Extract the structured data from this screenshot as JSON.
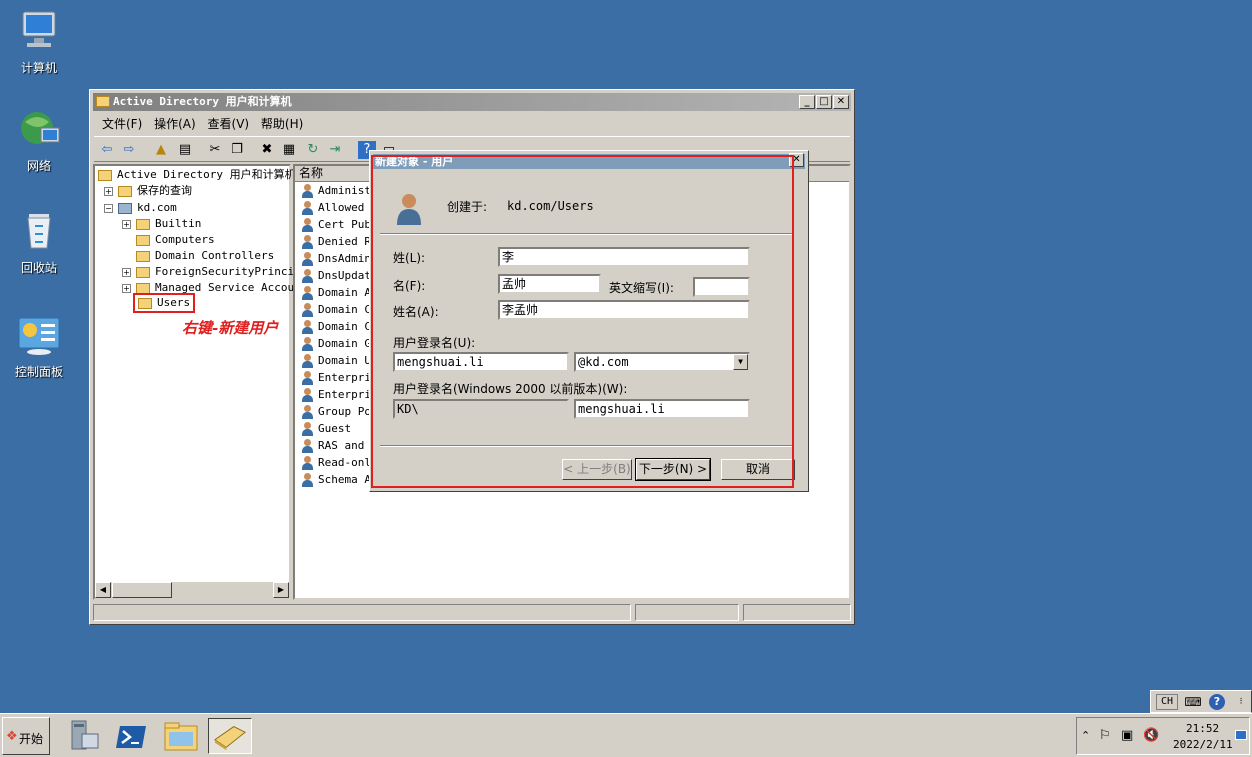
{
  "desktop": {
    "icons": [
      {
        "label": "计算机",
        "icon": "computer-icon"
      },
      {
        "label": "网络",
        "icon": "network-icon"
      },
      {
        "label": "回收站",
        "icon": "recycle-bin-icon"
      },
      {
        "label": "控制面板",
        "icon": "control-panel-icon"
      }
    ]
  },
  "window": {
    "title": "Active Directory 用户和计算机",
    "menu": [
      "文件(F)",
      "操作(A)",
      "查看(V)",
      "帮助(H)"
    ],
    "tree": {
      "root": "Active Directory 用户和计算机",
      "items": [
        "保存的查询",
        "kd.com",
        "Builtin",
        "Computers",
        "Domain Controllers",
        "ForeignSecurityPrincip",
        "Managed Service Accour",
        "Users"
      ]
    },
    "list": {
      "header": "名称",
      "items": [
        "Administr",
        "Allowed R",
        "Cert Publ",
        "Denied RO",
        "DnsAdmins",
        "DnsUpdate",
        "Domain Ad",
        "Domain Co",
        "Domain Co",
        "Domain Gu",
        "Domain Us",
        "Enterpris",
        "Enterpris",
        "Group Pol",
        "Guest",
        "RAS and I",
        "Read-only",
        "Schema Ad"
      ]
    }
  },
  "annotation": {
    "text": "右键-新建用户",
    "color": "#e02020"
  },
  "dialog": {
    "title": "新建对象 - 用户",
    "created_in_label": "创建于:",
    "created_in_value": "kd.com/Users",
    "last_name_label": "姓(L):",
    "last_name_value": "李",
    "first_name_label": "名(F):",
    "first_name_value": "孟帅",
    "initials_label": "英文缩写(I):",
    "initials_value": "",
    "full_name_label": "姓名(A):",
    "full_name_value": "李孟帅",
    "logon_label": "用户登录名(U):",
    "logon_value": "mengshuai.li",
    "domain_value": "@kd.com",
    "prewin_label": "用户登录名(Windows 2000 以前版本)(W):",
    "prewin_domain": "KD\\",
    "prewin_value": "mengshuai.li",
    "back_button": "< 上一步(B)",
    "next_button": "下一步(N) >",
    "cancel_button": "取消"
  },
  "taskbar": {
    "start": "开始",
    "lang": "CH",
    "time": "21:52",
    "date": "2022/2/11"
  },
  "colors": {
    "desktop": "#3a6ea5",
    "highlight": "#e02020"
  }
}
